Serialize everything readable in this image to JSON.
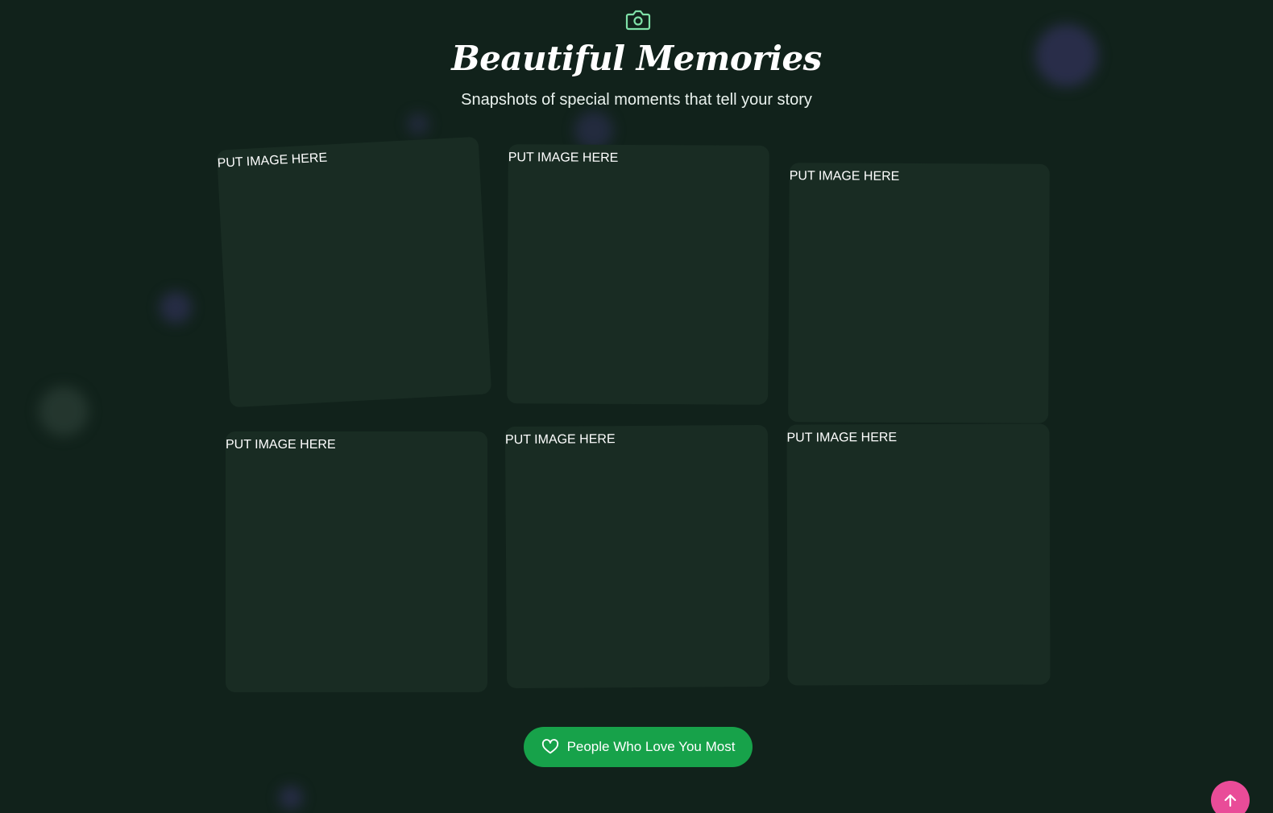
{
  "header": {
    "icon": "camera-icon",
    "title": "Beautiful Memories",
    "subtitle": "Snapshots of special moments that tell your story"
  },
  "gallery": {
    "cards": [
      {
        "label": "PUT IMAGE HERE"
      },
      {
        "label": "PUT IMAGE HERE"
      },
      {
        "label": "PUT IMAGE HERE"
      },
      {
        "label": "PUT IMAGE HERE"
      },
      {
        "label": "PUT IMAGE HERE"
      },
      {
        "label": "PUT IMAGE HERE"
      }
    ]
  },
  "actions": {
    "love_button_label": "People Who Love You Most",
    "love_button_icon": "heart-icon",
    "scroll_top_icon": "arrow-up-icon"
  },
  "colors": {
    "background": "#11221b",
    "card": "#192c23",
    "accent_green": "#17a24a",
    "camera_icon": "#7fe0a8",
    "scroll_top": "#e94c98"
  }
}
